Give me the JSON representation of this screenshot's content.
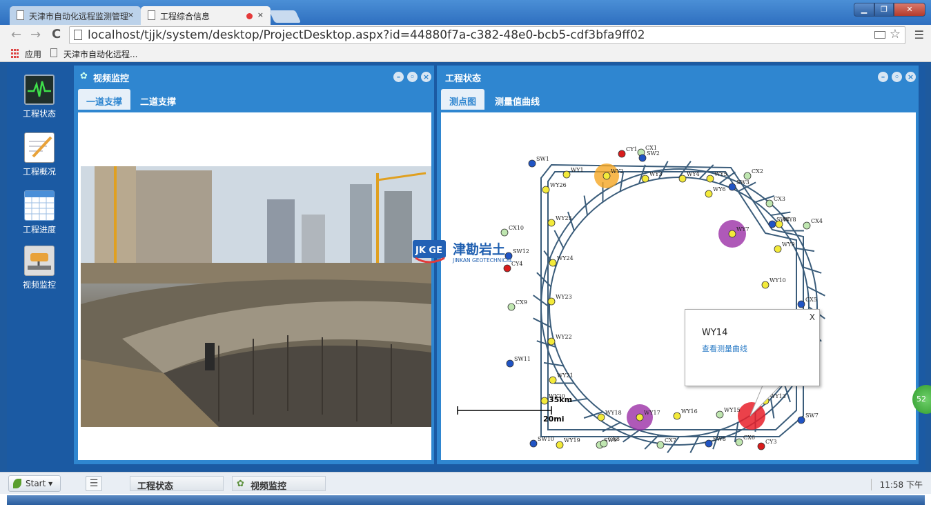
{
  "browser": {
    "tabs": [
      {
        "label": "天津市自动化远程监测管理",
        "active": false
      },
      {
        "label": "工程综合信息",
        "active": true
      }
    ],
    "url": "localhost/tjjk/system/desktop/ProjectDesktop.aspx?id=44880f7a-c382-48e0-bcb5-cdf3bfa9ff02",
    "bookmarks": {
      "apps": "应用",
      "item": "天津市自动化远程..."
    }
  },
  "desktop_icons": [
    {
      "label": "工程状态",
      "icon": "pulse-monitor-icon"
    },
    {
      "label": "工程概况",
      "icon": "notepad-icon"
    },
    {
      "label": "工程进度",
      "icon": "calendar-icon"
    },
    {
      "label": "视频监控",
      "icon": "camera-icon"
    }
  ],
  "video_panel": {
    "title": "视频监控",
    "tabs": [
      "一道支撑",
      "二道支撑"
    ],
    "active_tab": 0
  },
  "status_panel": {
    "title": "工程状态",
    "tabs": [
      "测点图",
      "测量值曲线"
    ],
    "active_tab": 0,
    "scale": {
      "km": "35km",
      "mi": "20mi"
    },
    "popup": {
      "title": "WY14",
      "link": "查看测量曲线",
      "close": "X"
    }
  },
  "logo": {
    "abbr": "JK GE",
    "cn": "津勘岩土",
    "en": "JINKAN GEOTECHNICAL"
  },
  "map_points": [
    {
      "label": "SW1"
    },
    {
      "label": "CY1"
    },
    {
      "label": "CX1"
    },
    {
      "label": "SW2"
    },
    {
      "label": "WY1"
    },
    {
      "label": "WY2"
    },
    {
      "label": "WY3"
    },
    {
      "label": "WY4"
    },
    {
      "label": "WY5"
    },
    {
      "label": "WY6"
    },
    {
      "label": "CX2"
    },
    {
      "label": "SW3"
    },
    {
      "label": "WY26"
    },
    {
      "label": "CX3"
    },
    {
      "label": "SW4"
    },
    {
      "label": "WY8"
    },
    {
      "label": "CX4"
    },
    {
      "label": "WY7"
    },
    {
      "label": "WY25"
    },
    {
      "label": "CX10"
    },
    {
      "label": "SW12"
    },
    {
      "label": "CY4"
    },
    {
      "label": "WY24"
    },
    {
      "label": "WY9"
    },
    {
      "label": "WY10"
    },
    {
      "label": "CX9"
    },
    {
      "label": "WY23"
    },
    {
      "label": "CX5"
    },
    {
      "label": "WY22"
    },
    {
      "label": "SW11"
    },
    {
      "label": "WY21"
    },
    {
      "label": "WY20"
    },
    {
      "label": "WY13"
    },
    {
      "label": "WY18"
    },
    {
      "label": "WY17"
    },
    {
      "label": "WY16"
    },
    {
      "label": "WY15"
    },
    {
      "label": "SW10"
    },
    {
      "label": "WY19"
    },
    {
      "label": "SW9"
    },
    {
      "label": "CX8"
    },
    {
      "label": "CX7"
    },
    {
      "label": "SW8"
    },
    {
      "label": "CX6"
    },
    {
      "label": "CY3"
    },
    {
      "label": "SW7"
    }
  ],
  "taskbar": {
    "start": "Start",
    "items": [
      "工程状态",
      "视频监控"
    ],
    "clock": "11:58 下午",
    "badge": "52"
  },
  "colors": {
    "panel_blue": "#2f86d0",
    "desktop_blue": "#1b5aa3",
    "point_yellow": "#f3ea3a",
    "point_blue": "#2054c4",
    "point_red": "#d91c1c",
    "point_green": "#bfe6b0",
    "alert_orange": "#f5a623",
    "alert_purple": "#9b2fa6",
    "alert_red": "#e8202a"
  }
}
